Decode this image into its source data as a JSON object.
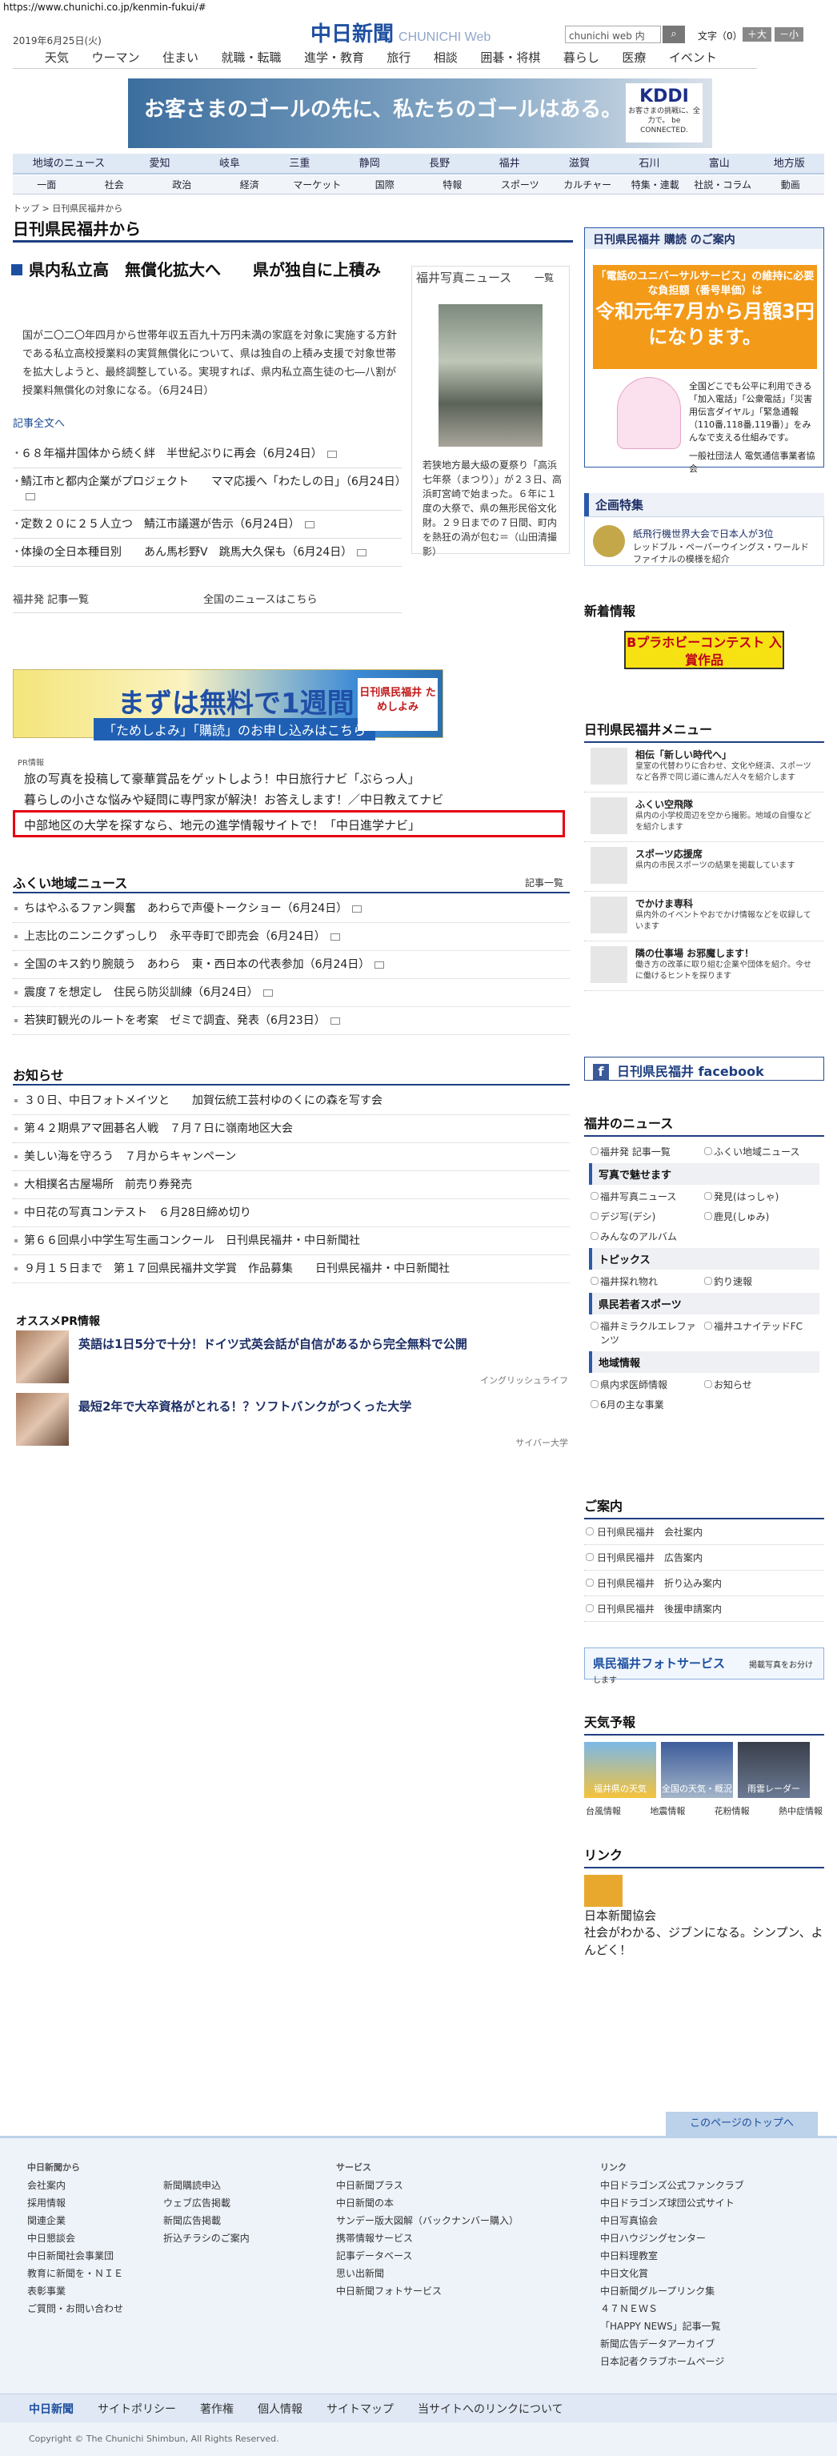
{
  "url": "https://www.chunichi.co.jp/kenmin-fukui/#",
  "header": {
    "date": "2019年6月25日(火)",
    "logo": "中日新聞",
    "logo_en": "CHUNICHI Web",
    "search_placeholder": "chunichi web 内",
    "search_icon": "search-icon",
    "font_label": "文字（0）",
    "font_big": "＋大",
    "font_small": "－小"
  },
  "gnav": [
    "天気",
    "ウーマン",
    "住まい",
    "就職・転職",
    "進学・教育",
    "旅行",
    "相談",
    "囲碁・将棋",
    "暮らし",
    "医療",
    "イベント"
  ],
  "banner": {
    "text": "お客さまのゴールの先に、私たちのゴールはある。",
    "brand": "KDDI",
    "brand_sub": "お客さまの挑戦に、全力で。 be CONNECTED."
  },
  "region_nav": [
    "地域のニュース",
    "愛知",
    "岐阜",
    "三重",
    "静岡",
    "長野",
    "福井",
    "滋賀",
    "石川",
    "富山",
    "地方版"
  ],
  "cat_nav": [
    "一面",
    "社会",
    "政治",
    "経済",
    "マーケット",
    "国際",
    "特報",
    "スポーツ",
    "カルチャー",
    "特集・連載",
    "社説・コラム",
    "動画"
  ],
  "breadcrumb": "トップ > 日刊県民福井から",
  "page_title": "日刊県民福井から",
  "lead": {
    "title": "県内私立高　無償化拡大へ　　県が独自に上積み",
    "body": "国が二〇二〇年四月から世帯年収五百九十万円未満の家庭を対象に実施する方針である私立高校授業料の実質無償化について、県は独自の上積み支援で対象世帯を拡大しようと、最終調整している。実現すれば、県内私立高生徒の七―八割が授業料無償化の対象になる。（6月24日）",
    "more": "記事全文へ"
  },
  "photo": {
    "title": "福井写真ニュース",
    "list": "一覧",
    "caption": "若狭地方最大級の夏祭り「高浜七年祭（まつり）」が２３日、高浜町宮崎で始まった。６年に１度の大祭で、県の無形民俗文化財。２９日までの７日間、町内を熱狂の渦が包む＝（山田清撮影）"
  },
  "news1": [
    "６８年福井国体から続く絆　半世紀ぶりに再会（6月24日）",
    "鯖江市と都内企業がプロジェクト　　ママ応援へ「わたしの日」（6月24日）",
    "定数２０に２５人立つ　鯖江市議選が告示（6月24日）",
    "体操の全日本種目別　　あん馬杉野V　跳馬大久保も（6月24日）"
  ],
  "row2": {
    "left": "福井発 記事一覧",
    "right": "全国のニュースはこちら"
  },
  "ad2": {
    "text": "まずは無料で1週間",
    "btn": "「ためしよみ」「購読」のお申し込みはこちら",
    "logo": "日刊県民福井 ためしよみ",
    "tag": "ためしよみ"
  },
  "pr": {
    "label": "PR情報",
    "items": [
      "旅の写真を投稿して豪華賞品をゲットしよう！中日旅行ナビ「ぶらっ人」",
      "暮らしの小さな悩みや疑問に専門家が解決！お答えします！／中日教えてナビ",
      "中部地区の大学を探すなら、地元の進学情報サイトで！「中日進学ナビ」"
    ]
  },
  "local": {
    "title": "ふくい地域ニュース",
    "more": "記事一覧",
    "items": [
      "ちはやふるファン興奮　あわらで声優トークショー（6月24日）",
      "上志比のニンニクずっしり　永平寺町で即売会（6月24日）",
      "全国のキス釣り腕競う　あわら　東・西日本の代表参加（6月24日）",
      "震度７を想定し　住民ら防災訓練（6月24日）",
      "若狭町観光のルートを考案　ゼミで調査、発表（6月23日）"
    ]
  },
  "oshirase": {
    "title": "お知らせ",
    "items": [
      "３０日、中日フォトメイツと　　加賀伝統工芸村ゆのくにの森を写す会",
      "第４２期県アマ囲碁名人戦　７月７日に嶺南地区大会",
      "美しい海を守ろう　７月からキャンペーン",
      "大相撲名古屋場所　前売り券発売",
      "中日花の写真コンテスト　６月28日締め切り",
      "第６６回県小中学生写生画コンクール　日刊県民福井・中日新聞社",
      "９月１５日まで　第１７回県民福井文学賞　作品募集　　日刊県民福井・中日新聞社"
    ]
  },
  "osusume": {
    "title": "オススメPR情報",
    "items": [
      {
        "t": "英語は1日5分で十分！ドイツ式英会話が自信があるから完全無料で公開",
        "s": "イングリッシュライフ"
      },
      {
        "t": "最短2年で大卒資格がとれる！？ソフトバンクがつくった大学",
        "s": "サイバー大学"
      }
    ]
  },
  "sidebar": {
    "koudoku": {
      "title": "日刊県民福井 購読 のご案内",
      "a": "「電話のユニバーサルサービス」の維持に必要な負担額（番号単価）は",
      "b": "令和元年7月から月額3円になります。",
      "text": "全国どこでも公平に利用できる「加入電話」「公衆電話」「災害用伝言ダイヤル」「緊急通報（110番,118番,119番）」をみんなで支える仕組みです。",
      "org": "一般社団法人 電気通信事業者協会"
    },
    "kikaku": {
      "title": "企画特集",
      "t": "紙飛行機世界大会で日本人が3位",
      "s": "レッドブル・ペーパーウイングス・ワールドファイナルの模様を紹介"
    },
    "shinchaku": {
      "title": "新着情報",
      "banner": "Bプラホビーコンテスト 入賞作品"
    },
    "menu": {
      "title": "日刊県民福井メニュー",
      "items": [
        {
          "t": "相伝「新しい時代へ」",
          "s": "皇室の代替わりに合わせ、文化や経済、スポーツなど各界で同じ道に進んだ人々を紹介します"
        },
        {
          "t": "ふくい空飛隊",
          "s": "県内の小学校周辺を空から撮影。地域の自慢などを紹介します"
        },
        {
          "t": "スポーツ応援席",
          "s": "県内の市民スポーツの結果を掲載しています"
        },
        {
          "t": "でかけま専科",
          "s": "県内外のイベントやおでかけ情報などを収録しています"
        },
        {
          "t": "隣の仕事場 お邪魔します！",
          "s": "働き方の改革に取り組む企業や団体を紹介。今せに働けるヒントを探ります"
        }
      ]
    },
    "facebook": "日刊県民福井 facebook",
    "fukui": {
      "title": "福井のニュース",
      "a": [
        "福井発 記事一覧",
        "ふくい地域ニュース"
      ],
      "photo_h": "写真で魅せます",
      "b": [
        "福井写真ニュース",
        "発見(はっしゃ)",
        "デジ写(デシ)",
        "鹿見(しゅみ)",
        "みんなのアルバム"
      ],
      "topics_h": "トピックス",
      "c": [
        "福井探れ物れ",
        "釣り速報"
      ],
      "sports_h": "県民若者スポーツ",
      "d": [
        "福井ミラクルエレファンツ",
        "福井ユナイテッドFC"
      ],
      "area_h": "地域情報",
      "e": [
        "県内求医師情報",
        "お知らせ",
        "6月の主な事業"
      ]
    },
    "annai": {
      "title": "ご案内",
      "items": [
        "日刊県民福井　会社案内",
        "日刊県民福井　広告案内",
        "日刊県民福井　折り込み案内",
        "日刊県民福井　後援申請案内"
      ]
    },
    "photoserv": "県民福井フォトサービス",
    "photoserv_sub": "掲載写真をお分けします",
    "tenki": {
      "title": "天気予報",
      "tiles": [
        "福井県の天気",
        "全国の天気・概況",
        "雨雲レーダー"
      ],
      "links": [
        "台風情報",
        "地震情報",
        "花粉情報",
        "熱中症情報"
      ]
    },
    "link": {
      "title": "リンク",
      "t": "日本新聞協会",
      "s": "社会がわかる、ジブンになる。シンプン、よんどく！"
    }
  },
  "pagetop": "このページのトップへ",
  "footer": {
    "col1_h": "中日新聞から",
    "col1": [
      "会社案内",
      "採用情報",
      "関連企業",
      "中日懇談会",
      "中日新聞社会事業団",
      "教育に新聞を・ＮＩＥ",
      "表彰事業",
      "ご質問・お問い合わせ"
    ],
    "col2": [
      "新聞購読申込",
      "ウェブ広告掲載",
      "新聞広告掲載",
      "折込チラシのご案内"
    ],
    "col3_h": "サービス",
    "col3": [
      "中日新聞プラス",
      "中日新聞の本",
      "サンデー版大図解（バックナンバー購入）",
      "携帯情報サービス",
      "記事データベース",
      "思い出新聞",
      "中日新聞フォトサービス"
    ],
    "col4_h": "リンク",
    "col4": [
      "中日ドラゴンズ公式ファンクラブ",
      "中日ドラゴンズ球団公式サイト",
      "中日写真協会",
      "中日ハウジングセンター",
      "中日料理教室",
      "中日文化賞",
      "中日新聞グループリンク集",
      "４７ＮＥＷＳ",
      "「HAPPY NEWS」記事一覧",
      "新聞広告データアーカイブ",
      "日本記者クラブホームページ"
    ],
    "bar_logo": "中日新聞",
    "bar": [
      "サイトポリシー",
      "著作権",
      "個人情報",
      "サイトマップ",
      "当サイトへのリンクについて"
    ],
    "copy": "Copyright © The Chunichi Shimbun, All Rights Reserved."
  }
}
